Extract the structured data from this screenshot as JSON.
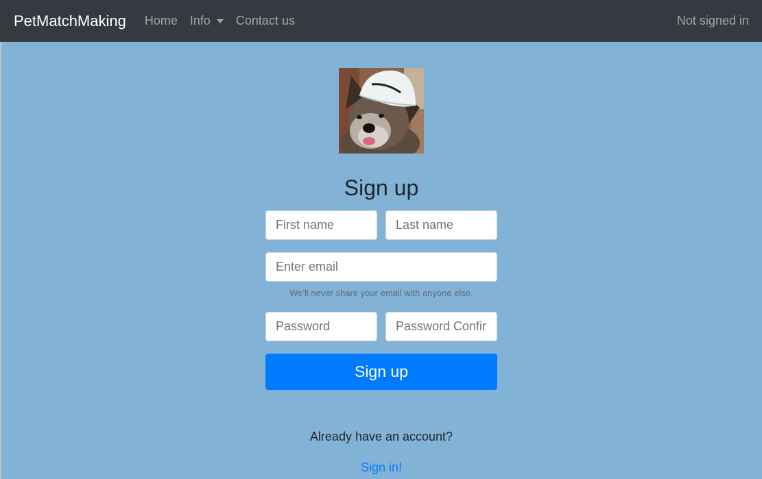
{
  "navbar": {
    "brand": "PetMatchMaking",
    "links": [
      {
        "label": "Home"
      },
      {
        "label": "Info"
      },
      {
        "label": "Contact us"
      }
    ],
    "status": "Not signed in"
  },
  "form": {
    "title": "Sign up",
    "first_name_placeholder": "First name",
    "last_name_placeholder": "Last name",
    "email_placeholder": "Enter email",
    "email_help": "We'll never share your email with anyone else.",
    "password_placeholder": "Password",
    "password_confirm_placeholder": "Password Confirmation",
    "submit_label": "Sign up"
  },
  "footer": {
    "prompt": "Already have an account?",
    "signin_link": "Sign in!"
  },
  "colors": {
    "background": "#82b3d6",
    "navbar": "#343a40",
    "primary": "#007bff"
  },
  "icons": {
    "info_dropdown": "chevron-down-icon"
  }
}
